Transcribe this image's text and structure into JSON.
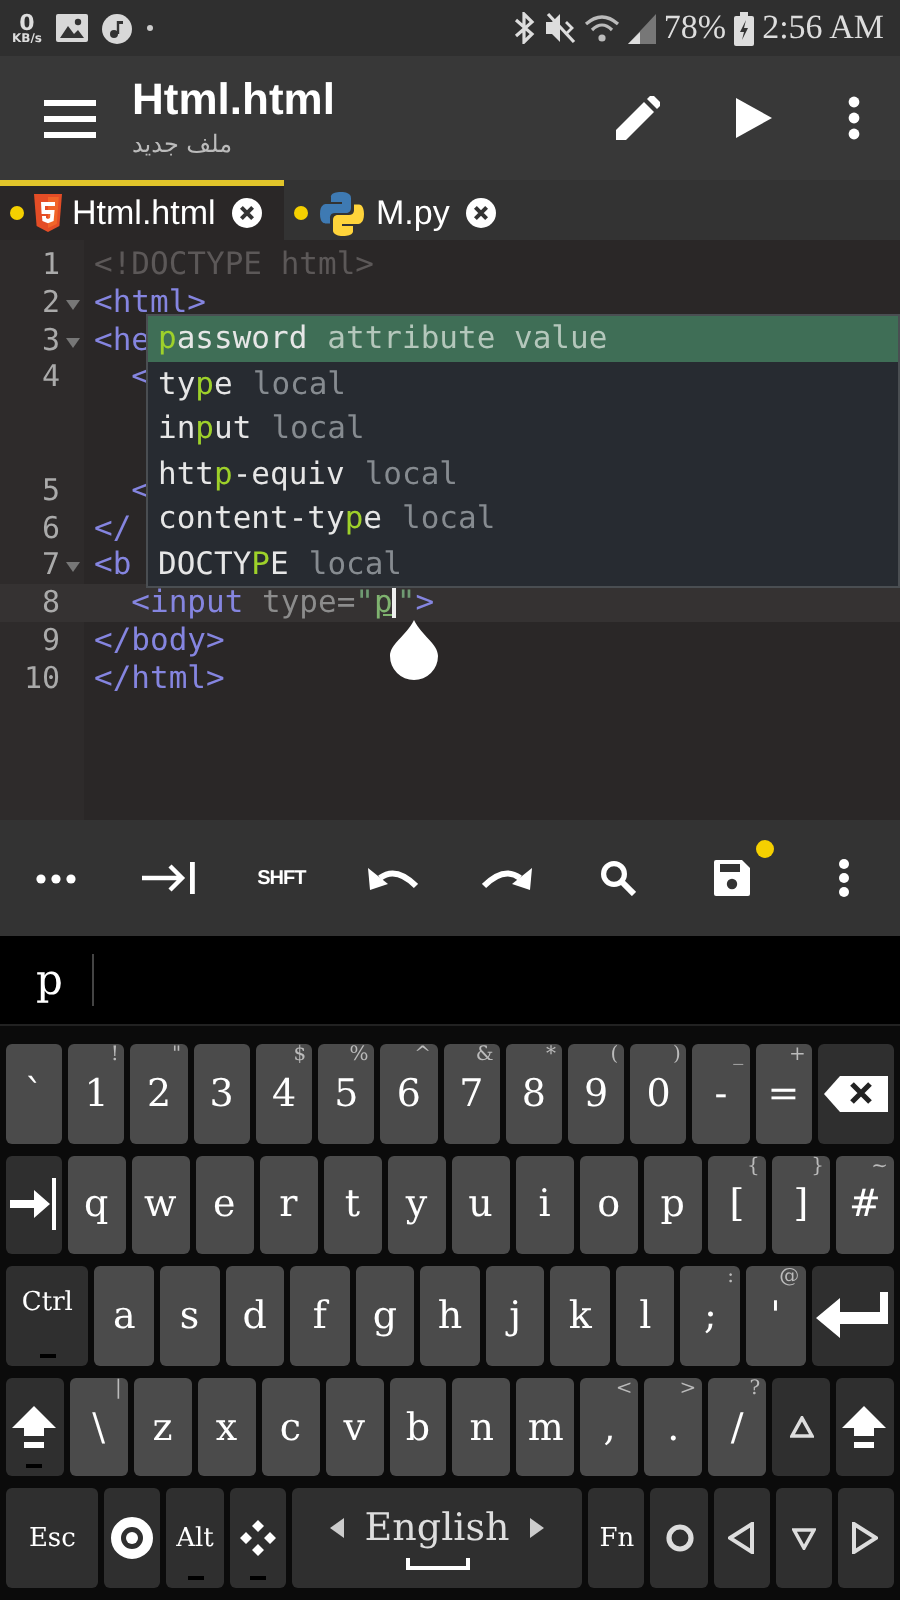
{
  "status_bar": {
    "net_speed": "0",
    "net_unit": "KB/s",
    "battery": "78%",
    "time": "2:56 AM"
  },
  "app_bar": {
    "title": "Html.html",
    "subtitle": "ملف جديد",
    "actions": [
      {
        "kind": "edit"
      },
      {
        "kind": "run"
      },
      {
        "kind": "overflow"
      }
    ]
  },
  "tabs": [
    {
      "label": "Html.html",
      "kind": "html",
      "selected": true,
      "modified": true
    },
    {
      "label": "M.py",
      "kind": "python",
      "selected": false,
      "modified": true
    }
  ],
  "editor": {
    "lines": [
      {
        "number": "1",
        "fold": false,
        "tokens": [
          {
            "kind": "doctype",
            "text": "<!DOCTYPE html>"
          }
        ]
      },
      {
        "number": "2",
        "fold": true,
        "tokens": [
          {
            "kind": "tag",
            "text": "<html>"
          }
        ]
      },
      {
        "number": "3",
        "fold": true,
        "tokens": [
          {
            "kind": "tag",
            "text": "<he"
          }
        ]
      },
      {
        "number": "4",
        "fold": false,
        "wrapped": true,
        "tokens": [
          {
            "kind": "tag",
            "text": "  <"
          }
        ]
      },
      {
        "number": "5",
        "fold": false,
        "tokens": [
          {
            "kind": "tag",
            "text": "  <"
          }
        ]
      },
      {
        "number": "6",
        "fold": false,
        "tokens": [
          {
            "kind": "tag",
            "text": "</"
          }
        ]
      },
      {
        "number": "7",
        "fold": true,
        "tokens": [
          {
            "kind": "tag",
            "text": "<b"
          }
        ]
      },
      {
        "number": "8",
        "fold": false,
        "current": true,
        "tokens": [
          {
            "kind": "tag",
            "text": "  <input"
          },
          {
            "kind": "attr",
            "text": " type="
          },
          {
            "kind": "string",
            "text": "\""
          },
          {
            "kind": "match",
            "text": "p"
          },
          {
            "kind": "cursor"
          },
          {
            "kind": "string",
            "text": "\""
          },
          {
            "kind": "tag",
            "text": ">"
          }
        ]
      },
      {
        "number": "9",
        "fold": false,
        "tokens": [
          {
            "kind": "tag",
            "text": "</body>"
          }
        ]
      },
      {
        "number": "10",
        "fold": false,
        "tokens": [
          {
            "kind": "tag",
            "text": "</html>"
          }
        ]
      }
    ],
    "completions": [
      {
        "match": "p",
        "after": "assword",
        "detail": "attribute value",
        "selected": true
      },
      {
        "before": "ty",
        "match": "p",
        "after": "e",
        "detail": "local",
        "selected": false
      },
      {
        "before": "in",
        "match": "p",
        "after": "ut",
        "detail": "local",
        "selected": false
      },
      {
        "before": "htt",
        "match": "p",
        "after": "-equiv",
        "detail": "local",
        "selected": false
      },
      {
        "before": "content-ty",
        "match": "p",
        "after": "e",
        "detail": "local",
        "selected": false
      },
      {
        "before": "DOCTY",
        "match": "P",
        "after": "E",
        "detail": "local",
        "selected": false
      }
    ]
  },
  "toolbar": [
    {
      "kind": "more"
    },
    {
      "kind": "tab"
    },
    {
      "kind": "shift",
      "label": "SHFT"
    },
    {
      "kind": "undo"
    },
    {
      "kind": "redo"
    },
    {
      "kind": "search"
    },
    {
      "kind": "save",
      "unsaved": true
    },
    {
      "kind": "overflow"
    }
  ],
  "candidate_bar": {
    "text": "p"
  },
  "keyboard": {
    "rows": [
      {
        "keys": [
          {
            "kind": "char",
            "label": "`"
          },
          {
            "kind": "char",
            "label": "1",
            "hint": "!"
          },
          {
            "kind": "char",
            "label": "2",
            "hint": "\""
          },
          {
            "kind": "char",
            "label": "3"
          },
          {
            "kind": "char",
            "label": "4",
            "hint": "$"
          },
          {
            "kind": "char",
            "label": "5",
            "hint": "%"
          },
          {
            "kind": "char",
            "label": "6",
            "hint": "^"
          },
          {
            "kind": "char",
            "label": "7",
            "hint": "&"
          },
          {
            "kind": "char",
            "label": "8",
            "hint": "*"
          },
          {
            "kind": "char",
            "label": "9",
            "hint": "("
          },
          {
            "kind": "char",
            "label": "0",
            "hint": ")"
          },
          {
            "kind": "char",
            "label": "-",
            "hint": "_"
          },
          {
            "kind": "char",
            "label": "=",
            "hint": "+"
          },
          {
            "kind": "backspace"
          }
        ]
      },
      {
        "keys": [
          {
            "kind": "tab"
          },
          {
            "kind": "char",
            "label": "q"
          },
          {
            "kind": "char",
            "label": "w"
          },
          {
            "kind": "char",
            "label": "e"
          },
          {
            "kind": "char",
            "label": "r"
          },
          {
            "kind": "char",
            "label": "t"
          },
          {
            "kind": "char",
            "label": "y"
          },
          {
            "kind": "char",
            "label": "u"
          },
          {
            "kind": "char",
            "label": "i"
          },
          {
            "kind": "char",
            "label": "o"
          },
          {
            "kind": "char",
            "label": "p"
          },
          {
            "kind": "char",
            "label": "[",
            "hint": "{"
          },
          {
            "kind": "char",
            "label": "]",
            "hint": "}"
          },
          {
            "kind": "char",
            "label": "#",
            "hint": "~"
          }
        ]
      },
      {
        "keys": [
          {
            "kind": "ctrl",
            "label": "Ctrl",
            "indicator": true
          },
          {
            "kind": "char",
            "label": "a"
          },
          {
            "kind": "char",
            "label": "s"
          },
          {
            "kind": "char",
            "label": "d"
          },
          {
            "kind": "char",
            "label": "f"
          },
          {
            "kind": "char",
            "label": "g"
          },
          {
            "kind": "char",
            "label": "h"
          },
          {
            "kind": "char",
            "label": "j"
          },
          {
            "kind": "char",
            "label": "k"
          },
          {
            "kind": "char",
            "label": "l"
          },
          {
            "kind": "char",
            "label": ";",
            "hint": ":"
          },
          {
            "kind": "char",
            "label": "'",
            "hint": "@"
          },
          {
            "kind": "enter"
          }
        ]
      },
      {
        "keys": [
          {
            "kind": "shift",
            "indicator": true
          },
          {
            "kind": "char",
            "label": "\\",
            "hint": "|"
          },
          {
            "kind": "char",
            "label": "z"
          },
          {
            "kind": "char",
            "label": "x"
          },
          {
            "kind": "char",
            "label": "c"
          },
          {
            "kind": "char",
            "label": "v"
          },
          {
            "kind": "char",
            "label": "b"
          },
          {
            "kind": "char",
            "label": "n"
          },
          {
            "kind": "char",
            "label": "m"
          },
          {
            "kind": "char",
            "label": ",",
            "hint": "<"
          },
          {
            "kind": "char",
            "label": ".",
            "hint": ">"
          },
          {
            "kind": "char",
            "label": "/",
            "hint": "?"
          },
          {
            "kind": "arrow_up"
          },
          {
            "kind": "shift",
            "indicator": false
          }
        ]
      },
      {
        "keys": [
          {
            "kind": "esc",
            "label": "Esc"
          },
          {
            "kind": "settings"
          },
          {
            "kind": "alt",
            "label": "Alt",
            "indicator": true
          },
          {
            "kind": "dpad",
            "indicator": true
          },
          {
            "kind": "space",
            "label": "English"
          },
          {
            "kind": "fn",
            "label": "Fn"
          },
          {
            "kind": "circle"
          },
          {
            "kind": "arrow_left"
          },
          {
            "kind": "arrow_down"
          },
          {
            "kind": "arrow_right"
          }
        ]
      }
    ]
  }
}
